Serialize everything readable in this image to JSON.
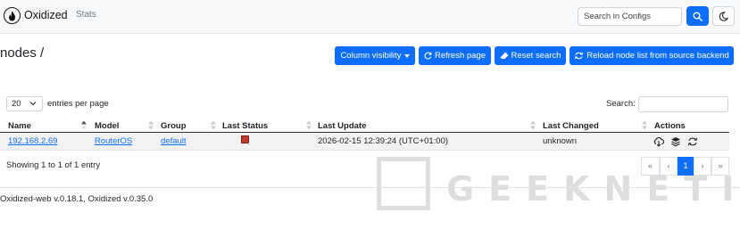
{
  "navbar": {
    "brand": "Oxidized",
    "links": [
      "Stats"
    ],
    "search": {
      "placeholder": "Search in Configs",
      "value": ""
    },
    "icons": {
      "logo": "oxidized-logo-icon",
      "search": "search-icon",
      "theme": "moon-icon"
    }
  },
  "page": {
    "title": "nodes /",
    "buttons": {
      "column_visibility": "Column visibility",
      "refresh": "Refresh page",
      "reset_search": "Reset search",
      "reload_nodes": "Reload node list from source backend"
    }
  },
  "table_controls": {
    "page_length": "20",
    "page_length_label": "entries per page",
    "search_label": "Search:",
    "search_value": ""
  },
  "table": {
    "columns": [
      "Name",
      "Model",
      "Group",
      "Last Status",
      "Last Update",
      "Last Changed",
      "Actions"
    ],
    "rows": [
      {
        "name": "192.168.2.69",
        "model": "RouterOS",
        "group": "default",
        "last_status": "failed",
        "last_update": "2026-02-15 12:39:24 (UTC+01:00)",
        "last_changed": "unknown",
        "actions": [
          "download-icon",
          "layers-icon",
          "sync-icon"
        ]
      }
    ]
  },
  "info": "Showing 1 to 1 of 1 entry",
  "pagination": {
    "first": "«",
    "prev": "‹",
    "current": "1",
    "next": "›",
    "last": "»"
  },
  "footer": "Oxidized-web v.0.18.1, Oxidized v.0.35.0",
  "watermark": {
    "text": "GEEKNETIC"
  },
  "colors": {
    "primary": "#0d6efd",
    "status_failed": "#c0392b",
    "navbar_bg": "#f8f9fa",
    "row_stripe": "#f2f2f2"
  }
}
